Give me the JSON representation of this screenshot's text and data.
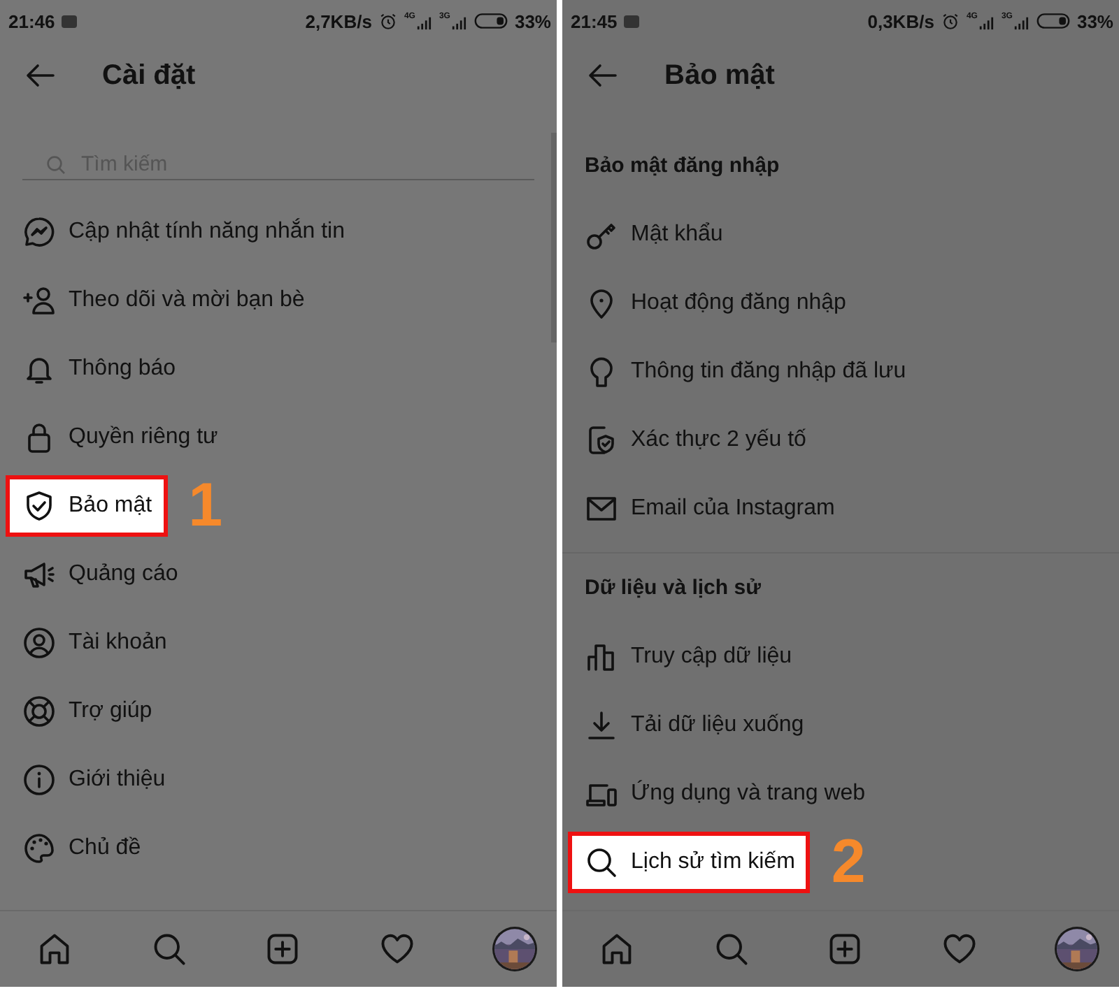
{
  "panels": [
    {
      "status_bar": {
        "time": "21:46",
        "speed": "2,7KB/s",
        "network_1": "4G",
        "network_2": "3G",
        "battery": "33%"
      },
      "header": {
        "title": "Cài đặt"
      },
      "search": {
        "placeholder": "Tìm kiếm"
      },
      "sections": [
        {
          "items": [
            {
              "label": "Cập nhật tính năng nhắn tin",
              "highlighted": false
            },
            {
              "label": "Theo dõi và mời bạn bè",
              "highlighted": false
            },
            {
              "label": "Thông báo",
              "highlighted": false
            },
            {
              "label": "Quyền riêng tư",
              "highlighted": false
            },
            {
              "label": "Bảo mật",
              "highlighted": true,
              "step": "1"
            },
            {
              "label": "Quảng cáo",
              "highlighted": false
            },
            {
              "label": "Tài khoản",
              "highlighted": false
            },
            {
              "label": "Trợ giúp",
              "highlighted": false
            },
            {
              "label": "Giới thiệu",
              "highlighted": false
            },
            {
              "label": "Chủ đề",
              "highlighted": false
            }
          ]
        }
      ]
    },
    {
      "status_bar": {
        "time": "21:45",
        "speed": "0,3KB/s",
        "network_1": "4G",
        "network_2": "3G",
        "battery": "33%"
      },
      "header": {
        "title": "Bảo mật"
      },
      "sections": [
        {
          "heading": "Bảo mật đăng nhập",
          "items": [
            {
              "label": "Mật khẩu",
              "highlighted": false
            },
            {
              "label": "Hoạt động đăng nhập",
              "highlighted": false
            },
            {
              "label": "Thông tin đăng nhập đã lưu",
              "highlighted": false
            },
            {
              "label": "Xác thực 2 yếu tố",
              "highlighted": false
            },
            {
              "label": "Email của Instagram",
              "highlighted": false
            }
          ]
        },
        {
          "heading": "Dữ liệu và lịch sử",
          "items": [
            {
              "label": "Truy cập dữ liệu",
              "highlighted": false
            },
            {
              "label": "Tải dữ liệu xuống",
              "highlighted": false
            },
            {
              "label": "Ứng dụng và trang web",
              "highlighted": false
            },
            {
              "label": "Lịch sử tìm kiếm",
              "highlighted": true,
              "step": "2"
            }
          ]
        }
      ]
    }
  ]
}
